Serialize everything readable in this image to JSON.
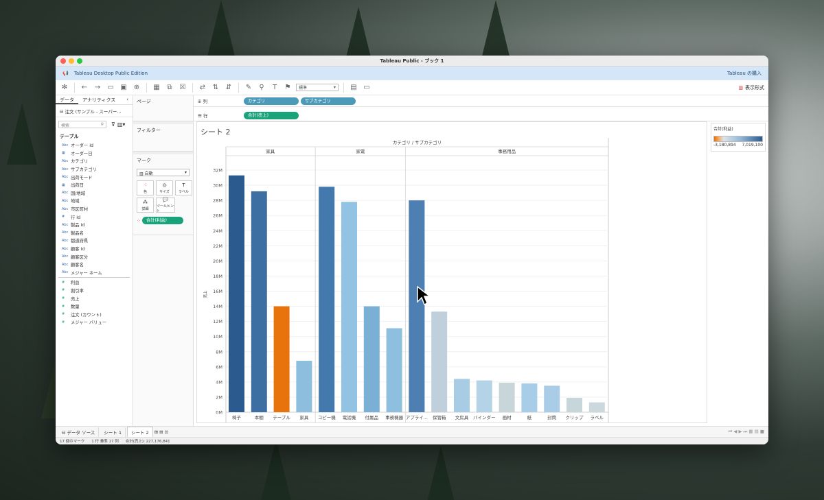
{
  "window": {
    "title": "Tableau Public - ブック 1"
  },
  "infobar": {
    "edition": "Tableau Desktop Public Edition",
    "buy": "Tableau の購入"
  },
  "toolbar": {
    "fit": "標準",
    "show_me": "表示形式"
  },
  "datapane": {
    "tabs": [
      "データ",
      "アナリティクス"
    ],
    "source": "注文 (サンプル - スーパー...",
    "search_placeholder": "検索",
    "table_header": "テーブル",
    "dimensions": [
      {
        "type": "Abc",
        "name": "オーダー Id"
      },
      {
        "type": "cal",
        "name": "オーダー日"
      },
      {
        "type": "Abc",
        "name": "カテゴリ"
      },
      {
        "type": "Abc",
        "name": "サブカテゴリ"
      },
      {
        "type": "Abc",
        "name": "出荷モード"
      },
      {
        "type": "cal",
        "name": "出荷日"
      },
      {
        "type": "Abc",
        "name": "国/地域"
      },
      {
        "type": "Abc",
        "name": "地域"
      },
      {
        "type": "Abc",
        "name": "市区町村"
      },
      {
        "type": "#",
        "name": "行 Id"
      },
      {
        "type": "Abc",
        "name": "製品 Id"
      },
      {
        "type": "Abc",
        "name": "製品名"
      },
      {
        "type": "Abc",
        "name": "都道府県"
      },
      {
        "type": "Abc",
        "name": "顧客 Id"
      },
      {
        "type": "Abc",
        "name": "顧客区分"
      },
      {
        "type": "Abc",
        "name": "顧客名"
      },
      {
        "type": "Abc",
        "name": "メジャー ネーム"
      }
    ],
    "measures": [
      {
        "type": "#",
        "name": "利益"
      },
      {
        "type": "#",
        "name": "割引率"
      },
      {
        "type": "#",
        "name": "売上"
      },
      {
        "type": "#",
        "name": "数量"
      },
      {
        "type": "#",
        "name": "注文 (カウント)"
      },
      {
        "type": "#",
        "name": "メジャー バリュー"
      }
    ]
  },
  "shelves": {
    "pages": "ページ",
    "filters": "フィルター",
    "marks": "マーク",
    "mark_type": "自動",
    "mark_buttons": [
      "色",
      "サイズ",
      "ラベル",
      "詳細",
      "ツールヒント"
    ],
    "color_pill": "合計(利益)"
  },
  "columns": {
    "label": "列",
    "pills": [
      "カテゴリ",
      "サブカテゴリ"
    ]
  },
  "rows": {
    "label": "行",
    "pills": [
      "合計(売上)"
    ]
  },
  "sheet": {
    "title": "シート 2"
  },
  "legend": {
    "title": "合計(利益)",
    "min": "-3,180,894",
    "max": "7,019,100"
  },
  "chart_data": {
    "type": "bar",
    "header": "カテゴリ / サブカテゴリ",
    "ylabel": "売上",
    "ylim": [
      0,
      32000000
    ],
    "yticks": [
      "0M",
      "2M",
      "4M",
      "6M",
      "8M",
      "10M",
      "12M",
      "14M",
      "16M",
      "18M",
      "20M",
      "22M",
      "24M",
      "26M",
      "28M",
      "30M",
      "32M"
    ],
    "groups": [
      {
        "name": "家具",
        "bars": [
          {
            "label": "椅子",
            "value": 31300000,
            "color": "#2b5b8e"
          },
          {
            "label": "本棚",
            "value": 29200000,
            "color": "#3d6fa3"
          },
          {
            "label": "テーブル",
            "value": 14000000,
            "color": "#e8720c"
          },
          {
            "label": "家具",
            "value": 6800000,
            "color": "#8dbede"
          }
        ]
      },
      {
        "name": "家電",
        "bars": [
          {
            "label": "コピー機",
            "value": 29800000,
            "color": "#4479ad"
          },
          {
            "label": "電話機",
            "value": 27800000,
            "color": "#92c3e3"
          },
          {
            "label": "付属品",
            "value": 14000000,
            "color": "#7aafd6"
          },
          {
            "label": "事務機器",
            "value": 11100000,
            "color": "#8ebfdf"
          }
        ]
      },
      {
        "name": "事務用品",
        "bars": [
          {
            "label": "アプライ...",
            "value": 28000000,
            "color": "#4e7fb3"
          },
          {
            "label": "保管箱",
            "value": 13300000,
            "color": "#bfd0dc"
          },
          {
            "label": "文房具",
            "value": 4400000,
            "color": "#a8cce4"
          },
          {
            "label": "バインダー",
            "value": 4200000,
            "color": "#b4d3e6"
          },
          {
            "label": "画材",
            "value": 3900000,
            "color": "#c9d6d9"
          },
          {
            "label": "紙",
            "value": 3800000,
            "color": "#a8cde7"
          },
          {
            "label": "封筒",
            "value": 3500000,
            "color": "#a9cde6"
          },
          {
            "label": "クリップ",
            "value": 1900000,
            "color": "#c6d6da"
          },
          {
            "label": "ラベル",
            "value": 1300000,
            "color": "#cbd9dd"
          }
        ]
      }
    ]
  },
  "tabs": {
    "datasource": "データ ソース",
    "sheets": [
      "シート 1",
      "シート 2"
    ]
  },
  "status": {
    "marks": "17 個のマーク",
    "dims": "1 行 兼準 17 列",
    "sum": "合計(売上): 227,176,841"
  }
}
